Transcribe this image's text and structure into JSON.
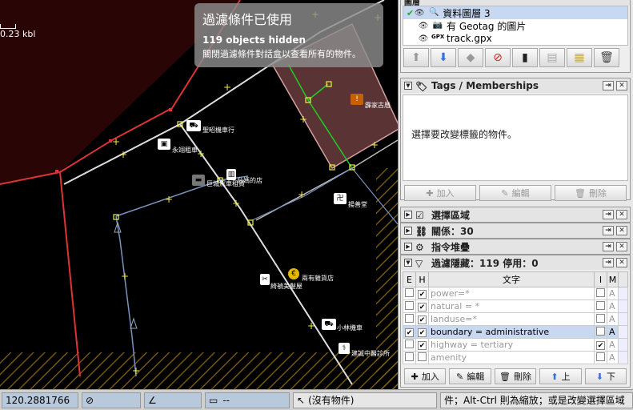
{
  "map": {
    "scale_label": "0.23 kbl",
    "filter_overlay": {
      "title": "過濾條件已使用",
      "count": "119 objects hidden",
      "hint": "關閉過濾條件對話盒以查看所有的物件。"
    },
    "pois": [
      {
        "label": "聖昭機車行",
        "icon": "moto-icon"
      },
      {
        "label": "永翊租車",
        "icon": "car-icon"
      },
      {
        "label": "巨城駕車租賃",
        "icon": "car-icon"
      },
      {
        "label": "台媽的店",
        "icon": "shop-icon"
      },
      {
        "label": "揚善堂",
        "icon": "temple-icon"
      },
      {
        "label": "霹家古厝",
        "icon": "warning-icon"
      },
      {
        "label": "兩有雜貨店",
        "icon": "euro-icon"
      },
      {
        "label": "綺禎美髮屋",
        "icon": "hair-icon"
      },
      {
        "label": "小林機車",
        "icon": "moto-icon"
      },
      {
        "label": "建誠中醫診所",
        "icon": "clinic-icon"
      }
    ]
  },
  "layers": {
    "header": "圖層",
    "items": [
      {
        "name": "資料圖層 3",
        "selected": true,
        "icon": "osm-layer-icon"
      },
      {
        "name": "有 Geotag 的圖片",
        "selected": false,
        "icon": "camera-icon"
      },
      {
        "name": "track.gpx",
        "selected": false,
        "icon": "gpx-icon"
      }
    ]
  },
  "tags": {
    "header": "Tags / Memberships",
    "empty_text": "選擇要改變標籤的物件。",
    "buttons": {
      "add": "加入",
      "edit": "編輯",
      "delete": "刪除"
    }
  },
  "collapsed": [
    {
      "label": "選擇區域"
    },
    {
      "label": "關係：30"
    },
    {
      "label": "指令堆疊"
    }
  ],
  "filter_dialog": {
    "header": "過濾隱藏：119 停用：0",
    "columns": {
      "e": "E",
      "h": "H",
      "text": "文字",
      "i": "I",
      "m": "M"
    },
    "rows": [
      {
        "text": "power=*",
        "e": false,
        "h": true,
        "i": false,
        "m": "A",
        "selected": false
      },
      {
        "text": "natural = *",
        "e": false,
        "h": true,
        "i": false,
        "m": "A",
        "selected": false
      },
      {
        "text": "landuse=*",
        "e": false,
        "h": true,
        "i": false,
        "m": "A",
        "selected": false
      },
      {
        "text": "boundary = administrative",
        "e": true,
        "h": true,
        "i": false,
        "m": "A",
        "selected": true
      },
      {
        "text": "highway = tertiary",
        "e": false,
        "h": true,
        "i": true,
        "m": "A",
        "selected": false
      },
      {
        "text": "amenity",
        "e": false,
        "h": false,
        "i": false,
        "m": "A",
        "selected": false
      }
    ],
    "buttons": {
      "add": "加入",
      "edit": "編輯",
      "delete": "刪除",
      "up": "上",
      "down": "下"
    }
  },
  "status": {
    "longitude": "120.2881766",
    "angle": "",
    "length": "--",
    "selection": "(沒有物件)",
    "help": "件；Alt-Ctrl 則為縮放；或是改變選擇區域"
  }
}
